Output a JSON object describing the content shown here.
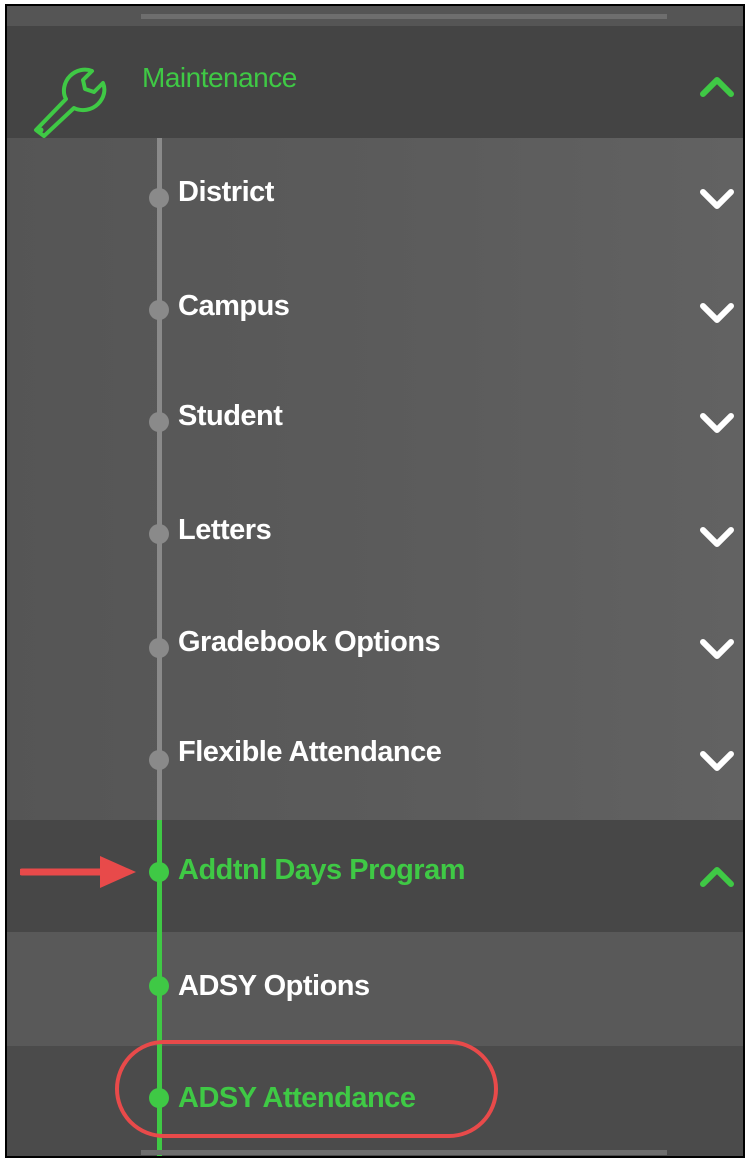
{
  "menu": {
    "section": {
      "label": "Maintenance",
      "icon": "wrench-icon",
      "expanded": true
    },
    "items": [
      {
        "label": "District",
        "expanded": false
      },
      {
        "label": "Campus",
        "expanded": false
      },
      {
        "label": "Student",
        "expanded": false
      },
      {
        "label": "Letters",
        "expanded": false
      },
      {
        "label": "Gradebook Options",
        "expanded": false
      },
      {
        "label": "Flexible Attendance",
        "expanded": false
      }
    ],
    "active_group": {
      "label": "Addtnl Days Program",
      "expanded": true,
      "children": [
        {
          "label": "ADSY Options"
        },
        {
          "label": "ADSY Attendance"
        }
      ]
    }
  },
  "colors": {
    "accent_green": "#3fc945",
    "annotation_red": "#e84a4a",
    "panel_gray": "#555555",
    "header_gray": "#444444"
  }
}
